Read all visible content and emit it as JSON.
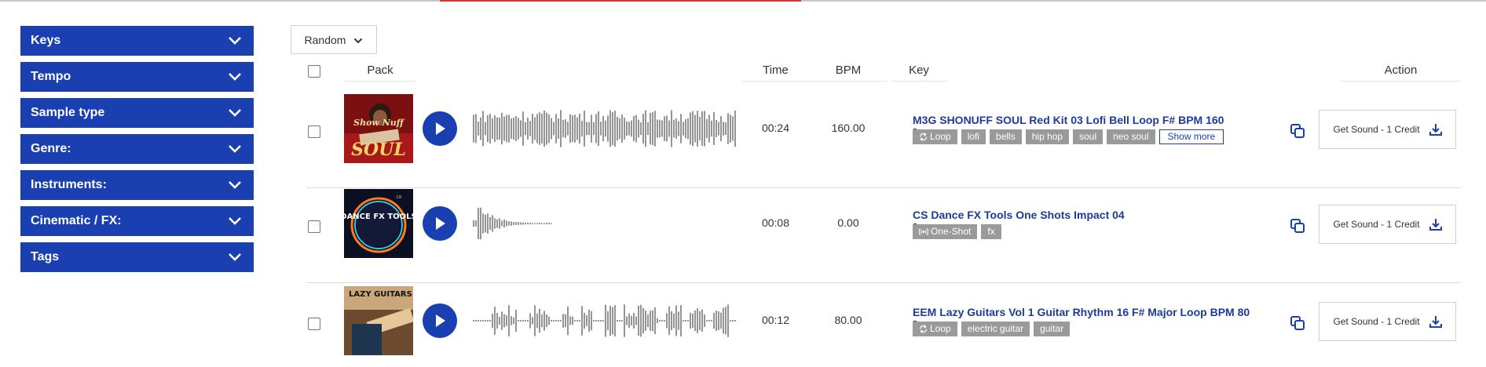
{
  "filters": [
    {
      "label": "Keys"
    },
    {
      "label": "Tempo"
    },
    {
      "label": "Sample type"
    },
    {
      "label": "Genre:"
    },
    {
      "label": "Instruments:"
    },
    {
      "label": "Cinematic / FX:"
    },
    {
      "label": "Tags"
    }
  ],
  "sort": {
    "label": "Random"
  },
  "headers": {
    "pack": "Pack",
    "time": "Time",
    "bpm": "BPM",
    "key": "Key",
    "action": "Action"
  },
  "rows": [
    {
      "cover_text": "SOUL",
      "time": "00:24",
      "bpm": "160.00",
      "key": "-",
      "title": "M3G SHONUFF SOUL Red Kit 03 Lofi Bell Loop F# BPM 160",
      "type_tag": "Loop",
      "tags": [
        "lofi",
        "bells",
        "hip hop",
        "soul",
        "neo soul"
      ],
      "more": "Show more",
      "action": "Get Sound - 1 Credit"
    },
    {
      "cover_text": "DANCE FX TOOLS",
      "time": "00:08",
      "bpm": "0.00",
      "key": "-",
      "title": "CS Dance FX Tools One Shots Impact 04",
      "type_tag": "One-Shot",
      "tags": [
        "fx"
      ],
      "action": "Get Sound - 1 Credit"
    },
    {
      "cover_text": "LAZY GUITARS",
      "time": "00:12",
      "bpm": "80.00",
      "key": "-",
      "title": "EEM Lazy Guitars Vol 1 Guitar Rhythm 16 F# Major Loop BPM 80",
      "type_tag": "Loop",
      "tags": [
        "electric guitar",
        "guitar"
      ],
      "action": "Get Sound - 1 Credit"
    }
  ],
  "colors": {
    "brand": "#1a3fb0",
    "title": "#1d3b9c",
    "tag": "#9a9a9a",
    "waveform": "#7a7a7a"
  },
  "icons": [
    "chevron-down-icon",
    "play-icon",
    "copy-icon",
    "download-icon",
    "loop-icon",
    "one-shot-icon"
  ]
}
